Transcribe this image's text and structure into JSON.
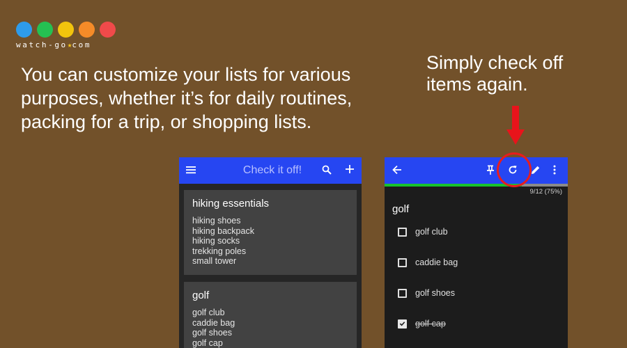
{
  "logo": {
    "dot_colors": [
      "#2e9bea",
      "#25c052",
      "#f2c40d",
      "#f58b28",
      "#f04a4a"
    ],
    "text": "watch-go",
    "star": "★",
    "suffix": "com"
  },
  "caption_left": "You can customize your lists for various purposes, whether it’s for daily routines, packing for a trip, or shopping lists.",
  "caption_right": "Simply check off items again.",
  "accent": {
    "appbar": "#2646f2",
    "progress": "#17c22e",
    "highlight": "#e81d1d"
  },
  "left_phone": {
    "title": "Check it off!",
    "icons": [
      "menu-icon",
      "search-icon",
      "plus-icon"
    ],
    "cards": [
      {
        "title": "hiking essentials",
        "items": [
          "hiking shoes",
          "hiking backpack",
          "hiking socks",
          "trekking poles",
          "small tower"
        ]
      },
      {
        "title": "golf",
        "items": [
          "golf club",
          "caddie bag",
          "golf shoes",
          "golf cap"
        ]
      }
    ]
  },
  "right_phone": {
    "icons": [
      "back-arrow-icon",
      "pin-icon",
      "reset-icon",
      "edit-icon",
      "more-vert-icon"
    ],
    "progress_text": "9/12 (75%)",
    "progress_fraction": 0.75,
    "list_title": "golf",
    "items": [
      {
        "label": "golf club",
        "checked": false
      },
      {
        "label": "caddie bag",
        "checked": false
      },
      {
        "label": "golf shoes",
        "checked": false
      },
      {
        "label": "golf cap",
        "checked": true
      }
    ]
  }
}
